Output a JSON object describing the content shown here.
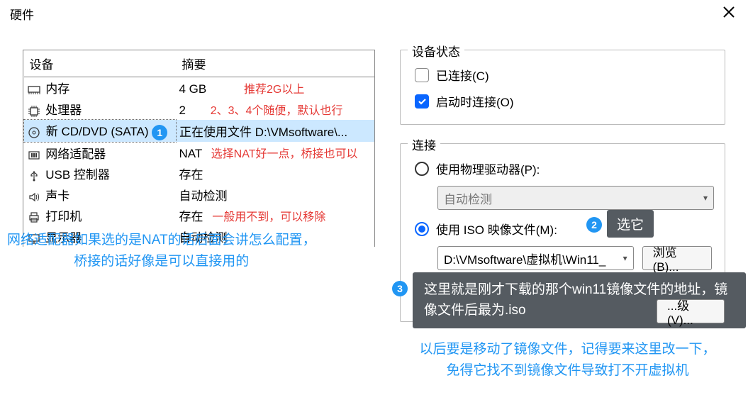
{
  "title": "硬件",
  "columns": {
    "device": "设备",
    "summary": "摘要"
  },
  "devices": [
    {
      "name": "内存",
      "summary": "4 GB",
      "ann": "推荐2G以上"
    },
    {
      "name": "处理器",
      "summary": "2",
      "ann": "2、3、4个随便，默认也行"
    },
    {
      "name": "新 CD/DVD (SATA)",
      "summary": "正在使用文件 D:\\VMsoftware\\...",
      "ann": "",
      "selected": true
    },
    {
      "name": "网络适配器",
      "summary": "NAT",
      "ann": "选择NAT好一点，桥接也可以"
    },
    {
      "name": "USB 控制器",
      "summary": "存在",
      "ann": ""
    },
    {
      "name": "声卡",
      "summary": "自动检测",
      "ann": ""
    },
    {
      "name": "打印机",
      "summary": "存在",
      "ann": "一般用不到，可以移除"
    },
    {
      "name": "显示器",
      "summary": "自动检测",
      "ann": ""
    }
  ],
  "note_left_1": "网络适配器如果选的是NAT的话后面会讲怎么配置，",
  "note_left_2": "桥接的话好像是可以直接用的",
  "device_state": {
    "legend": "设备状态",
    "connected": "已连接(C)",
    "connect_on_power": "启动时连接(O)"
  },
  "connection": {
    "legend": "连接",
    "use_physical": "使用物理驱动器(P):",
    "physical_value": "自动检测",
    "use_iso": "使用 ISO 映像文件(M):",
    "iso_value": "D:\\VMsoftware\\虚拟机\\Win11_",
    "browse": "浏览(B)...",
    "advanced": "...级(V)..."
  },
  "badges": {
    "b1": "1",
    "b2": "2",
    "b3": "3"
  },
  "tooltip_select": "选它",
  "tooltip_iso": "这里就是刚才下载的那个win11镜像文件的地址，镜像文件后最为.iso",
  "note_bottom_1": "以后要是移动了镜像文件，记得要来这里改一下，",
  "note_bottom_2": "免得它找不到镜像文件导致打不开虚拟机"
}
